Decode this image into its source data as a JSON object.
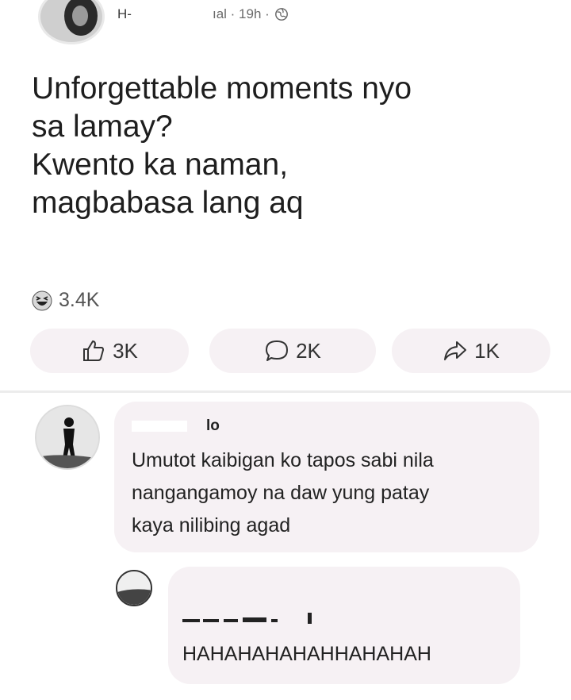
{
  "post": {
    "author_name": "H-",
    "meta": "ıal · 19h ·",
    "privacy_icon": "globe-icon",
    "text_lines": [
      "Unforgettable moments nyo",
      "sa lamay?",
      "Kwento ka naman,",
      "magbabasa lang aq"
    ],
    "reaction_icon": "haha-icon",
    "reaction_count": "3.4K"
  },
  "actions": {
    "like_count": "3K",
    "comment_count": "2K",
    "share_count": "1K"
  },
  "comment": {
    "author_name": "lo",
    "text_lines": [
      "Umutot kaibigan ko tapos sabi nila",
      "nangangamoy na daw yung patay",
      "kaya nilibing agad"
    ]
  },
  "reply": {
    "text": "HAHAHAHAHAHHAHAHAH"
  },
  "colors": {
    "bubble": "#f6f1f4",
    "text": "#1e1e1e",
    "muted": "#6b6b6b"
  }
}
